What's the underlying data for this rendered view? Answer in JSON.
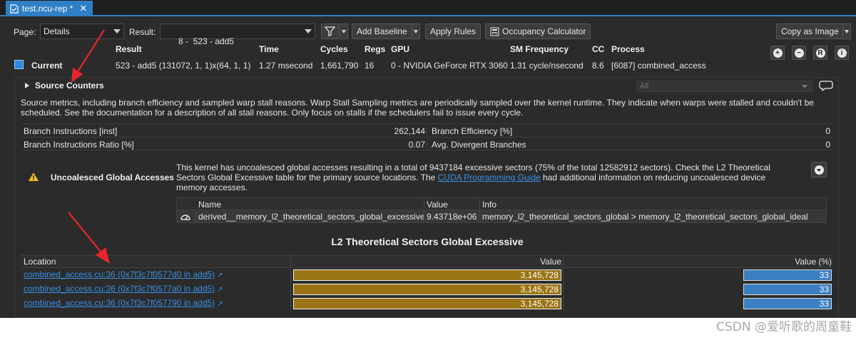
{
  "tab": {
    "title": "test.ncu-rep *",
    "close": "✕"
  },
  "toolbar": {
    "page_label": "Page:",
    "page_value": "Details",
    "result_label": "Result:",
    "result_value": "8 -  523 - add5",
    "add_baseline": "Add Baseline",
    "apply_rules": "Apply Rules",
    "occupancy_calculator": "Occupancy Calculator",
    "copy_as_image": "Copy as Image"
  },
  "results": {
    "headers": [
      "Result",
      "Time",
      "Cycles",
      "Regs",
      "GPU",
      "SM Frequency",
      "CC",
      "Process"
    ],
    "current_label": "Current",
    "values": [
      "523 - add5 (131072, 1, 1)x(64, 1, 1)",
      "1.27 msecond",
      "1,661,790",
      "16",
      "0 - NVIDIA GeForce RTX 3060",
      "1.31 cycle/nsecond",
      "8.6",
      "[6087] combined_access"
    ],
    "swatch_color": "#2a8ae0"
  },
  "section": {
    "title": "Source Counters",
    "filter_value": "All",
    "description": "Source metrics, including branch efficiency and sampled warp stall reasons. Warp Stall Sampling metrics are periodically sampled over the kernel runtime. They indicate when warps were stalled and couldn't be scheduled. See the documentation for a description of all stall reasons. Only focus on stalls if the schedulers fail to issue every cycle.",
    "metrics": [
      {
        "name": "Branch Instructions [inst]",
        "value": "262,144",
        "name2": "Branch Efficiency [%]",
        "value2": "0"
      },
      {
        "name": "Branch Instructions Ratio [%]",
        "value": "0.07",
        "name2": "Avg. Divergent Branches",
        "value2": "0"
      }
    ],
    "rule": {
      "title": "Uncoalesced Global Accesses",
      "text_before": "This kernel has uncoalesced global accesses resulting in a total of 9437184 excessive sectors (75% of the total 12582912 sectors). Check the L2 Theoretical Sectors Global Excessive table for the primary source locations. The ",
      "link": "CUDA Programming Guide",
      "text_after": " had additional information on reducing uncoalesced device memory accesses.",
      "table": {
        "headers": [
          "Name",
          "Value",
          "Info"
        ],
        "row": [
          "derived__memory_l2_theoretical_sectors_global_excessive",
          "9.43718e+06",
          "memory_l2_theoretical_sectors_global > memory_l2_theoretical_sectors_global_ideal"
        ]
      }
    },
    "chart_title": "L2 Theoretical Sectors Global Excessive",
    "location_table": {
      "headers": [
        "Location",
        "Value",
        "Value (%)"
      ],
      "rows": [
        {
          "location": "combined_access.cu:36 (0x7f3c7f0577d0 in add5)",
          "value": "3,145,728",
          "percent": "33",
          "fraction": 1.0,
          "pct_fraction": 0.33
        },
        {
          "location": "combined_access.cu:36 (0x7f3c7f0577a0 in add5)",
          "value": "3,145,728",
          "percent": "33",
          "fraction": 1.0,
          "pct_fraction": 0.33
        },
        {
          "location": "combined_access.cu:36 (0x7f3c7f057790 in add5)",
          "value": "3,145,728",
          "percent": "33",
          "fraction": 1.0,
          "pct_fraction": 0.33
        }
      ],
      "value_bar_color": "#9a7414",
      "percent_bar_color": "#3a7fc1"
    }
  },
  "watermark": "CSDN @爱听歌的周童鞋"
}
